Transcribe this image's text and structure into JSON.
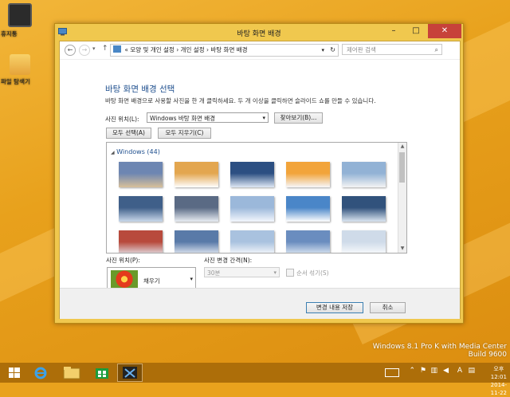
{
  "desktop": {
    "icons": [
      {
        "label": "휴지통"
      },
      {
        "label": "파일 탐색기"
      }
    ],
    "branding": {
      "line1": "Windows 8.1 Pro K with Media Center",
      "line2": "Build 9600"
    }
  },
  "window": {
    "title": "바탕 화면 배경",
    "controls": {
      "minimize": "–",
      "maximize": "□",
      "close": "✕"
    },
    "address": {
      "prefix": "«",
      "crumbs": [
        "모양 및 개인 설정",
        "개인 설정",
        "바탕 화면 배경"
      ],
      "separator": "›"
    },
    "search": {
      "placeholder": "제어판 검색"
    },
    "heading": "바탕 화면 배경 선택",
    "description": "바탕 화면 배경으로 사용할 사진을 한 개 클릭하세요. 두 개 이상을 클릭하면 슬라이드 쇼를 만들 수 있습니다.",
    "picture_location": {
      "label": "사진 위치(L):",
      "value": "Windows 바탕 화면 배경",
      "browse": "찾아보기(B)..."
    },
    "select_all": "모두 선택(A)",
    "clear_all": "모두 지우기(C)",
    "gallery": {
      "group_title": "Windows (44)",
      "thumbnails": [
        {
          "theme": "snowy-forest-sunset",
          "colors": [
            "#6d86b2",
            "#d8c09a"
          ]
        },
        {
          "theme": "golden-snow-trees",
          "colors": [
            "#e3a64f",
            "#ffffff"
          ]
        },
        {
          "theme": "blue-snow-forest",
          "colors": [
            "#2c4f82",
            "#dfe8f5"
          ]
        },
        {
          "theme": "sunrise-snow",
          "colors": [
            "#f2a43a",
            "#f6f7fb"
          ]
        },
        {
          "theme": "winter-lake",
          "colors": [
            "#92b2d5",
            "#f4f4f4"
          ]
        },
        {
          "theme": "snow-river",
          "colors": [
            "#3f5f89",
            "#c9d8ea"
          ]
        },
        {
          "theme": "frozen-shore",
          "colors": [
            "#5a6a84",
            "#e8edf3"
          ]
        },
        {
          "theme": "snow-path",
          "colors": [
            "#9bb8da",
            "#f3f7fd"
          ]
        },
        {
          "theme": "frosted-branches",
          "colors": [
            "#4a86c8",
            "#ffffff"
          ]
        },
        {
          "theme": "frosted-canal",
          "colors": [
            "#31527c",
            "#dbe5f1"
          ]
        },
        {
          "theme": "red-cabin",
          "colors": [
            "#b84a3c",
            "#e6ecf5"
          ]
        },
        {
          "theme": "snow-peaks",
          "colors": [
            "#597aa8",
            "#f1f4fa"
          ]
        },
        {
          "theme": "icy-trees",
          "colors": [
            "#a9c2df",
            "#ffffff"
          ]
        },
        {
          "theme": "blue-dusk-forest",
          "colors": [
            "#6a8dbf",
            "#e9f0f8"
          ]
        },
        {
          "theme": "snow-pines",
          "colors": [
            "#cfdbe9",
            "#ffffff"
          ]
        }
      ]
    },
    "picture_position": {
      "label": "사진 위치(P):",
      "value": "채우기"
    },
    "change_interval": {
      "label": "사진 변경 간격(N):",
      "value": "30분"
    },
    "shuffle": {
      "label": "순서 섞기(S)"
    },
    "save_button": "변경 내용 저장",
    "cancel_button": "취소"
  },
  "taskbar": {
    "apps": [
      {
        "name": "start-button-icon"
      },
      {
        "name": "internet-explorer-icon"
      },
      {
        "name": "file-explorer-icon"
      },
      {
        "name": "store-icon"
      },
      {
        "name": "control-panel-icon"
      }
    ],
    "tray": {
      "language": "A",
      "time": "오후 12:01",
      "date": "2014-11-22"
    }
  },
  "colors": {
    "accent": "#1e4f8e",
    "window_frame": "#f0c84e",
    "taskbar": "#ad6e09",
    "close_button": "#c7423a"
  }
}
